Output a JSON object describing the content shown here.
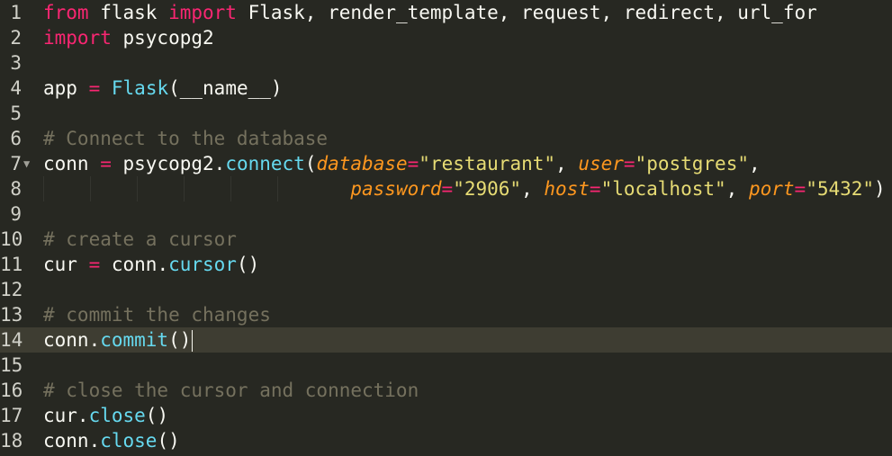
{
  "editor": {
    "lines": [
      {
        "num": "1",
        "tokens": [
          [
            "kw",
            "from"
          ],
          [
            "tx",
            " flask "
          ],
          [
            "kw",
            "import"
          ],
          [
            "tx",
            " Flask, render_template, request, redirect, url_for"
          ]
        ]
      },
      {
        "num": "2",
        "tokens": [
          [
            "kw",
            "import"
          ],
          [
            "tx",
            " psycopg2"
          ]
        ]
      },
      {
        "num": "3",
        "tokens": []
      },
      {
        "num": "4",
        "tokens": [
          [
            "tx",
            "app "
          ],
          [
            "op",
            "="
          ],
          [
            "tx",
            " "
          ],
          [
            "fn",
            "Flask"
          ],
          [
            "tx",
            "(__name__)"
          ]
        ]
      },
      {
        "num": "5",
        "tokens": []
      },
      {
        "num": "6",
        "tokens": [
          [
            "cm",
            "# Connect to the database"
          ]
        ]
      },
      {
        "num": "7",
        "fold": "▼",
        "tokens": [
          [
            "tx",
            "conn "
          ],
          [
            "op",
            "="
          ],
          [
            "tx",
            " psycopg2."
          ],
          [
            "fn",
            "connect"
          ],
          [
            "tx",
            "("
          ],
          [
            "param",
            "database"
          ],
          [
            "op",
            "="
          ],
          [
            "str",
            "\"restaurant\""
          ],
          [
            "tx",
            ", "
          ],
          [
            "param",
            "user"
          ],
          [
            "op",
            "="
          ],
          [
            "str",
            "\"postgres\""
          ],
          [
            "tx",
            ","
          ]
        ]
      },
      {
        "num": "8",
        "guides": true,
        "tokens": [
          [
            "tx",
            "                           "
          ],
          [
            "param",
            "password"
          ],
          [
            "op",
            "="
          ],
          [
            "str",
            "\"2906\""
          ],
          [
            "tx",
            ", "
          ],
          [
            "param",
            "host"
          ],
          [
            "op",
            "="
          ],
          [
            "str",
            "\"localhost\""
          ],
          [
            "tx",
            ", "
          ],
          [
            "param",
            "port"
          ],
          [
            "op",
            "="
          ],
          [
            "str",
            "\"5432\""
          ],
          [
            "tx",
            ")"
          ]
        ]
      },
      {
        "num": "9",
        "tokens": []
      },
      {
        "num": "10",
        "tokens": [
          [
            "cm",
            "# create a cursor"
          ]
        ]
      },
      {
        "num": "11",
        "tokens": [
          [
            "tx",
            "cur "
          ],
          [
            "op",
            "="
          ],
          [
            "tx",
            " conn."
          ],
          [
            "fn",
            "cursor"
          ],
          [
            "tx",
            "()"
          ]
        ]
      },
      {
        "num": "12",
        "tokens": []
      },
      {
        "num": "13",
        "tokens": [
          [
            "cm",
            "# commit the changes"
          ]
        ]
      },
      {
        "num": "14",
        "current": true,
        "tokens": [
          [
            "tx",
            "conn."
          ],
          [
            "fn",
            "commit"
          ],
          [
            "tx",
            "()"
          ]
        ]
      },
      {
        "num": "15",
        "tokens": []
      },
      {
        "num": "16",
        "tokens": [
          [
            "cm",
            "# close the cursor and connection"
          ]
        ]
      },
      {
        "num": "17",
        "tokens": [
          [
            "tx",
            "cur."
          ],
          [
            "fn",
            "close"
          ],
          [
            "tx",
            "()"
          ]
        ]
      },
      {
        "num": "18",
        "tokens": [
          [
            "tx",
            "conn."
          ],
          [
            "fn",
            "close"
          ],
          [
            "tx",
            "()"
          ]
        ]
      }
    ]
  }
}
